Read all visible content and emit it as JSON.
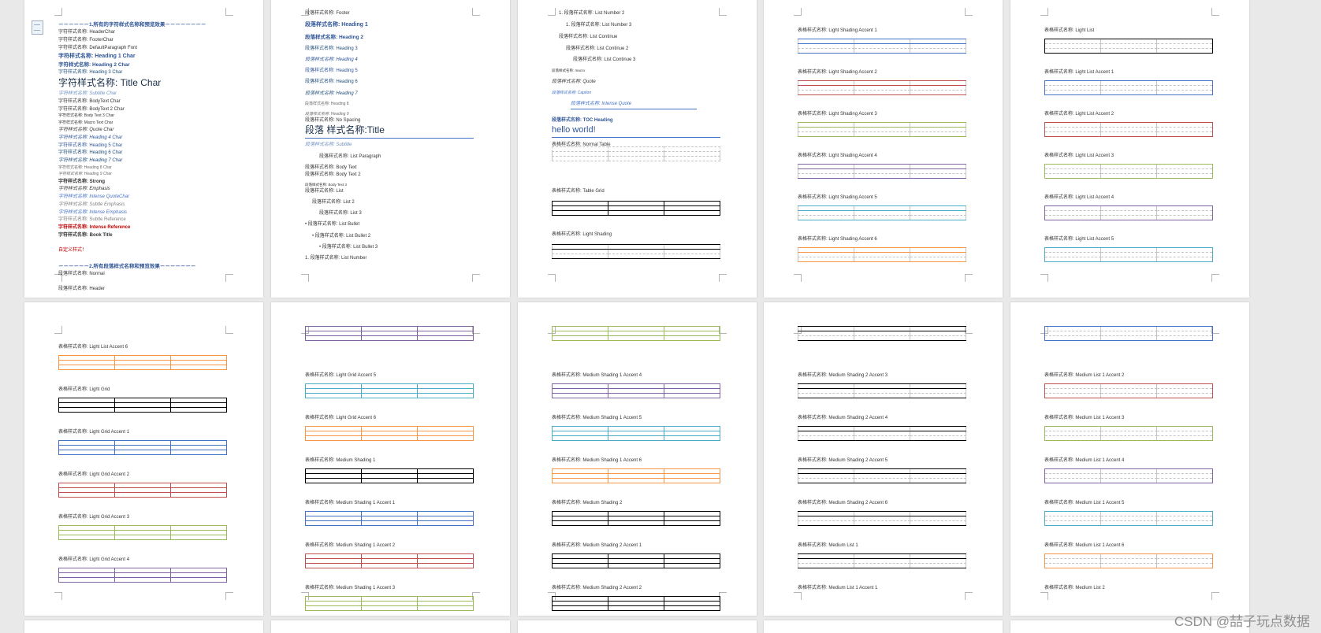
{
  "watermark": "CSDN @喆子玩点数据",
  "pages": [
    {
      "lines": [
        {
          "t": "－－－－－－1.所有的字符样式名称和预览效果－－－－－－－－",
          "c": "#2f5597",
          "s": 6.5,
          "b": true
        },
        {
          "t": "字符样式名称: HeaderChar"
        },
        {
          "t": "字符样式名称: FooterChar"
        },
        {
          "t": "字符样式名称: DefaultParagraph Font"
        },
        {
          "t": "字符样式名称: Heading 1 Char",
          "c": "#2f5597",
          "s": 7,
          "b": true
        },
        {
          "t": "字符样式名称: Heading 2 Char",
          "c": "#2f5597",
          "s": 6.5,
          "b": true
        },
        {
          "t": "字符样式名称: Heading 3 Char",
          "c": "#1f4d78"
        },
        {
          "t": "字符样式名称: Title Char",
          "c": "#1a2f4a",
          "s": 12
        },
        {
          "t": "字符样式名称: Subtitle Char",
          "c": "#6d8fbf",
          "i": true
        },
        {
          "t": "字符样式名称: BodyText Char"
        },
        {
          "t": "字符样式名称: BodyText 2 Char"
        },
        {
          "t": "字符样式名称: Body Text 3 Char",
          "s": 5
        },
        {
          "t": "字符样式名称: Macro Text Char",
          "s": 5
        },
        {
          "t": "字符样式名称: Quote Char",
          "i": true
        },
        {
          "t": "字符样式名称: Heading 4 Char",
          "c": "#2f5597",
          "i": true
        },
        {
          "t": "字符样式名称: Heading 5 Char",
          "c": "#2f5597"
        },
        {
          "t": "字符样式名称: Heading 6 Char",
          "c": "#1f4d78"
        },
        {
          "t": "字符样式名称: Heading 7 Char",
          "c": "#1f4d78",
          "i": true
        },
        {
          "t": "字符样式名称: Heading 8 Char",
          "c": "#6a6a6a",
          "s": 5
        },
        {
          "t": "字符样式名称: Heading 9 Char",
          "c": "#6a6a6a",
          "s": 5,
          "i": true
        },
        {
          "t": "字符样式名称: Strong",
          "b": true
        },
        {
          "t": "字符样式名称: Emphasis",
          "i": true
        },
        {
          "t": "字符样式名称: Intense QuoteChar",
          "c": "#4472c4",
          "i": true
        },
        {
          "t": "字符样式名称: Subtle Emphasis",
          "c": "#7f7f7f",
          "i": true
        },
        {
          "t": "字符样式名称: Intense Emphasis",
          "c": "#4472c4",
          "i": true
        },
        {
          "t": "字符样式名称: Subtle Reference",
          "c": "#7f7f7f"
        },
        {
          "t": "字符样式名称: Intense Reference",
          "c": "#c00000",
          "b": true
        },
        {
          "t": "字符样式名称: Book Title",
          "b": true
        },
        {
          "t": ""
        },
        {
          "t": "自定义样式！",
          "c": "#c00000"
        },
        {
          "t": ""
        },
        {
          "t": "－－－－－－2.所有段落样式名称和预览效果－－－－－－－",
          "c": "#2f5597",
          "s": 6.5,
          "b": true
        },
        {
          "t": "段落样式名称: Normal"
        },
        {
          "t": ""
        },
        {
          "t": "段落样式名称: Header"
        }
      ]
    },
    {
      "lines": [
        {
          "t": "段落样式名称: Footer"
        },
        {
          "t": ""
        },
        {
          "t": "段落样式名称: Heading 1",
          "c": "#2f5597",
          "s": 7,
          "b": true
        },
        {
          "t": ""
        },
        {
          "t": "段落样式名称: Heading 2",
          "c": "#2f5597",
          "s": 6.5,
          "b": true
        },
        {
          "t": ""
        },
        {
          "t": "段落样式名称: Heading 3",
          "c": "#1f4d78"
        },
        {
          "t": ""
        },
        {
          "t": "段落样式名称: Heading 4",
          "c": "#2f5597",
          "i": true
        },
        {
          "t": ""
        },
        {
          "t": "段落样式名称: Heading 5",
          "c": "#2f5597"
        },
        {
          "t": ""
        },
        {
          "t": "段落样式名称: Heading 6",
          "c": "#1f4d78"
        },
        {
          "t": ""
        },
        {
          "t": "段落样式名称: Heading 7",
          "c": "#1f4d78",
          "i": true
        },
        {
          "t": ""
        },
        {
          "t": "段落样式名称: Heading 8",
          "c": "#6a6a6a",
          "s": 5
        },
        {
          "t": ""
        },
        {
          "t": "段落样式名称: Heading 9",
          "c": "#6a6a6a",
          "s": 5,
          "i": true
        },
        {
          "t": "段落样式名称: No Spacing"
        },
        {
          "t": "段落 样式名称:Title",
          "c": "#1a2f4a",
          "s": 12,
          "u": "#4472c4"
        },
        {
          "t": ""
        },
        {
          "t": "段落样式名称: Subtitle",
          "c": "#6d8fbf",
          "i": true
        },
        {
          "t": ""
        },
        {
          "t": "段落样式名称: List Paragraph",
          "x": 18
        },
        {
          "t": ""
        },
        {
          "t": "段落样式名称: Body Text"
        },
        {
          "t": "段落样式名称: Body Text 2"
        },
        {
          "t": ""
        },
        {
          "t": "段落样式名称: Body Text 3",
          "s": 4.5
        },
        {
          "t": "段落样式名称: List"
        },
        {
          "t": ""
        },
        {
          "t": "段落样式名称: List 2",
          "x": 9
        },
        {
          "t": ""
        },
        {
          "t": "段落样式名称: List 3",
          "x": 18
        },
        {
          "t": ""
        },
        {
          "t": "•   段落样式名称: List Bullet"
        },
        {
          "t": ""
        },
        {
          "t": "•   段落样式名称: List Bullet 2",
          "x": 9
        },
        {
          "t": ""
        },
        {
          "t": "•   段落样式名称: List Bullet 3",
          "x": 18
        },
        {
          "t": ""
        },
        {
          "t": "1.   段落样式名称: List Number"
        }
      ]
    },
    {
      "lines": [
        {
          "t": "1.   段落样式名称: List Number 2",
          "x": 9
        },
        {
          "t": ""
        },
        {
          "t": "1.   段落样式名称: List Number 3",
          "x": 18
        },
        {
          "t": ""
        },
        {
          "t": "段落样式名称: List Continue",
          "x": 9
        },
        {
          "t": ""
        },
        {
          "t": "段落样式名称: List Continue 2",
          "x": 18
        },
        {
          "t": ""
        },
        {
          "t": "段落样式名称: List Continue 3",
          "x": 27
        },
        {
          "t": ""
        },
        {
          "t": "段落样式名称: macro",
          "s": 4.5
        },
        {
          "t": ""
        },
        {
          "t": "段落样式名称: Quote",
          "i": true
        },
        {
          "t": ""
        },
        {
          "t": "段落样式名称: Caption",
          "c": "#4472c4",
          "i": true,
          "s": 5
        },
        {
          "t": ""
        },
        {
          "t": "段落样式名称: Intense Quote",
          "c": "#4472c4",
          "i": true,
          "x": 24,
          "u": "#4472c4"
        },
        {
          "t": ""
        },
        {
          "t": ""
        },
        {
          "t": "段落样式名称: TOC Heading",
          "c": "#2f5597",
          "b": true
        },
        {
          "t": "hello world!",
          "c": "#2f5597",
          "s": 11,
          "u": "#4472c4"
        },
        {
          "t": ""
        },
        {
          "t": "表格样式名称: Normal Table"
        }
      ]
    }
  ],
  "page3_tables": [
    {
      "label": "表格样式名称: Normal Table"
    },
    {
      "label": "表格样式名称: Table Grid"
    },
    {
      "label": "表格样式名称: Light Shading"
    }
  ],
  "page4_tables": [
    {
      "label": "表格样式名称: Light Shading Accent 1",
      "color": "#4472c4"
    },
    {
      "label": "表格样式名称: Light Shading Accent 2",
      "color": "#c0504d"
    },
    {
      "label": "表格样式名称: Light Shading Accent 3",
      "color": "#9bbb59"
    },
    {
      "label": "表格样式名称: Light Shading Accent 4",
      "color": "#8064a2"
    },
    {
      "label": "表格样式名称: Light Shading Accent 5",
      "color": "#4bacc6"
    },
    {
      "label": "表格样式名称: Light Shading Accent 6",
      "color": "#f79646"
    }
  ],
  "page5_tables": [
    {
      "label": "表格样式名称: Light List",
      "color": "#000000"
    },
    {
      "label": "表格样式名称: Light List Accent 1",
      "color": "#4472c4"
    },
    {
      "label": "表格样式名称: Light List Accent 2",
      "color": "#c0504d"
    },
    {
      "label": "表格样式名称: Light List Accent 3",
      "color": "#9bbb59"
    },
    {
      "label": "表格样式名称: Light List Accent 4",
      "color": "#8064a2"
    },
    {
      "label": "表格样式名称: Light List Accent 5",
      "color": "#4bacc6"
    }
  ],
  "page6_tables": [
    {
      "label": "表格样式名称: Light List Accent 6",
      "color": "#f79646"
    },
    {
      "label": "表格样式名称: Light Grid",
      "color": "#000000"
    },
    {
      "label": "表格样式名称: Light Grid Accent 1",
      "color": "#4472c4"
    },
    {
      "label": "表格样式名称: Light Grid Accent 2",
      "color": "#c0504d"
    },
    {
      "label": "表格样式名称: Light Grid Accent 3",
      "color": "#9bbb59"
    },
    {
      "label": "表格样式名称: Light Grid Accent 4",
      "color": "#8064a2"
    }
  ],
  "page7_tables": [
    {
      "label": "",
      "color": "#8064a2"
    },
    {
      "label": "表格样式名称: Light Grid Accent 5",
      "color": "#4bacc6"
    },
    {
      "label": "表格样式名称: Light Grid Accent 6",
      "color": "#f79646"
    },
    {
      "label": "表格样式名称: Medium Shading 1",
      "color": "#000000"
    },
    {
      "label": "表格样式名称: Medium Shading 1 Accent 1",
      "color": "#4472c4"
    },
    {
      "label": "表格样式名称: Medium Shading 1 Accent 2",
      "color": "#c0504d"
    },
    {
      "label": "表格样式名称: Medium Shading 1 Accent 3",
      "color": "#9bbb59"
    }
  ],
  "page8_tables": [
    {
      "label": "",
      "color": "#9bbb59"
    },
    {
      "label": "表格样式名称: Medium Shading 1 Accent 4",
      "color": "#8064a2"
    },
    {
      "label": "表格样式名称: Medium Shading 1 Accent 5",
      "color": "#4bacc6"
    },
    {
      "label": "表格样式名称: Medium Shading 1 Accent 6",
      "color": "#f79646"
    },
    {
      "label": "表格样式名称: Medium Shading 2",
      "color": "#000000"
    },
    {
      "label": "表格样式名称: Medium Shading 2 Accent 1",
      "color": "#000000"
    },
    {
      "label": "表格样式名称: Medium Shading 2 Accent 2",
      "color": "#000000"
    }
  ],
  "page9_tables": [
    {
      "label": "",
      "color": "#000000"
    },
    {
      "label": "表格样式名称: Medium Shading 2 Accent 3",
      "color": "#000000"
    },
    {
      "label": "表格样式名称: Medium Shading 2 Accent 4",
      "color": "#000000"
    },
    {
      "label": "表格样式名称: Medium Shading 2 Accent 5",
      "color": "#000000"
    },
    {
      "label": "表格样式名称: Medium Shading 2 Accent 6",
      "color": "#000000"
    },
    {
      "label": "表格样式名称: Medium List 1",
      "color": "#000000"
    },
    {
      "label": "表格样式名称: Medium List 1 Accent 1",
      "color": ""
    }
  ],
  "page10_tables": [
    {
      "label": "",
      "color": "#4472c4"
    },
    {
      "label": "表格样式名称: Medium List 1 Accent 2",
      "color": "#c0504d"
    },
    {
      "label": "表格样式名称: Medium List 1 Accent 3",
      "color": "#9bbb59"
    },
    {
      "label": "表格样式名称: Medium List 1 Accent 4",
      "color": "#8064a2"
    },
    {
      "label": "表格样式名称: Medium List 1 Accent 5",
      "color": "#4bacc6"
    },
    {
      "label": "表格样式名称: Medium List 1 Accent 6",
      "color": "#f79646"
    },
    {
      "label": "表格样式名称: Medium List 2",
      "color": ""
    }
  ]
}
